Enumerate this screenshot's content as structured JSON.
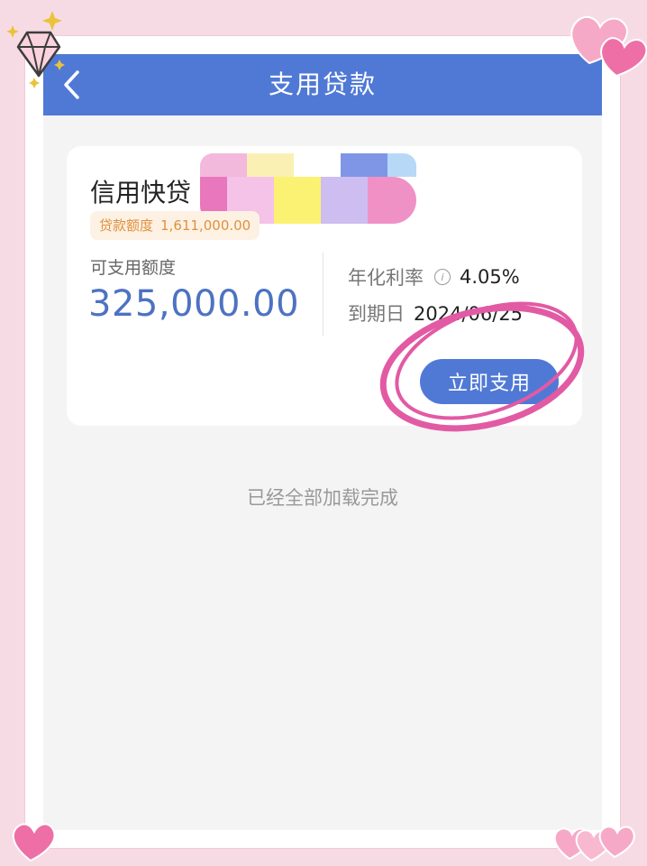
{
  "header": {
    "title": "支用贷款",
    "back_icon": "chevron-left-icon"
  },
  "loan_card": {
    "product_name": "信用快贷",
    "quota_tag": {
      "label": "贷款额度",
      "amount": "1,611,000.00"
    },
    "available": {
      "label": "可支用额度",
      "amount": "325,000.00"
    },
    "rate": {
      "label": "年化利率",
      "value": "4.05%",
      "info_icon": "info-icon"
    },
    "due": {
      "label": "到期日",
      "value": "2024/06/25"
    },
    "button_label": "立即支用"
  },
  "list_footer": {
    "text": "已经全部加载完成"
  },
  "colors": {
    "header_bg": "#5079d6",
    "amount_text": "#4d72c2",
    "tag_bg": "#fdf1e4",
    "tag_text": "#e0913e",
    "highlight_circle": "#e25aa4",
    "frame_bg": "#f7dbe4"
  },
  "decorations": [
    "heart-icon",
    "diamond-icon",
    "sparkle-icon"
  ]
}
